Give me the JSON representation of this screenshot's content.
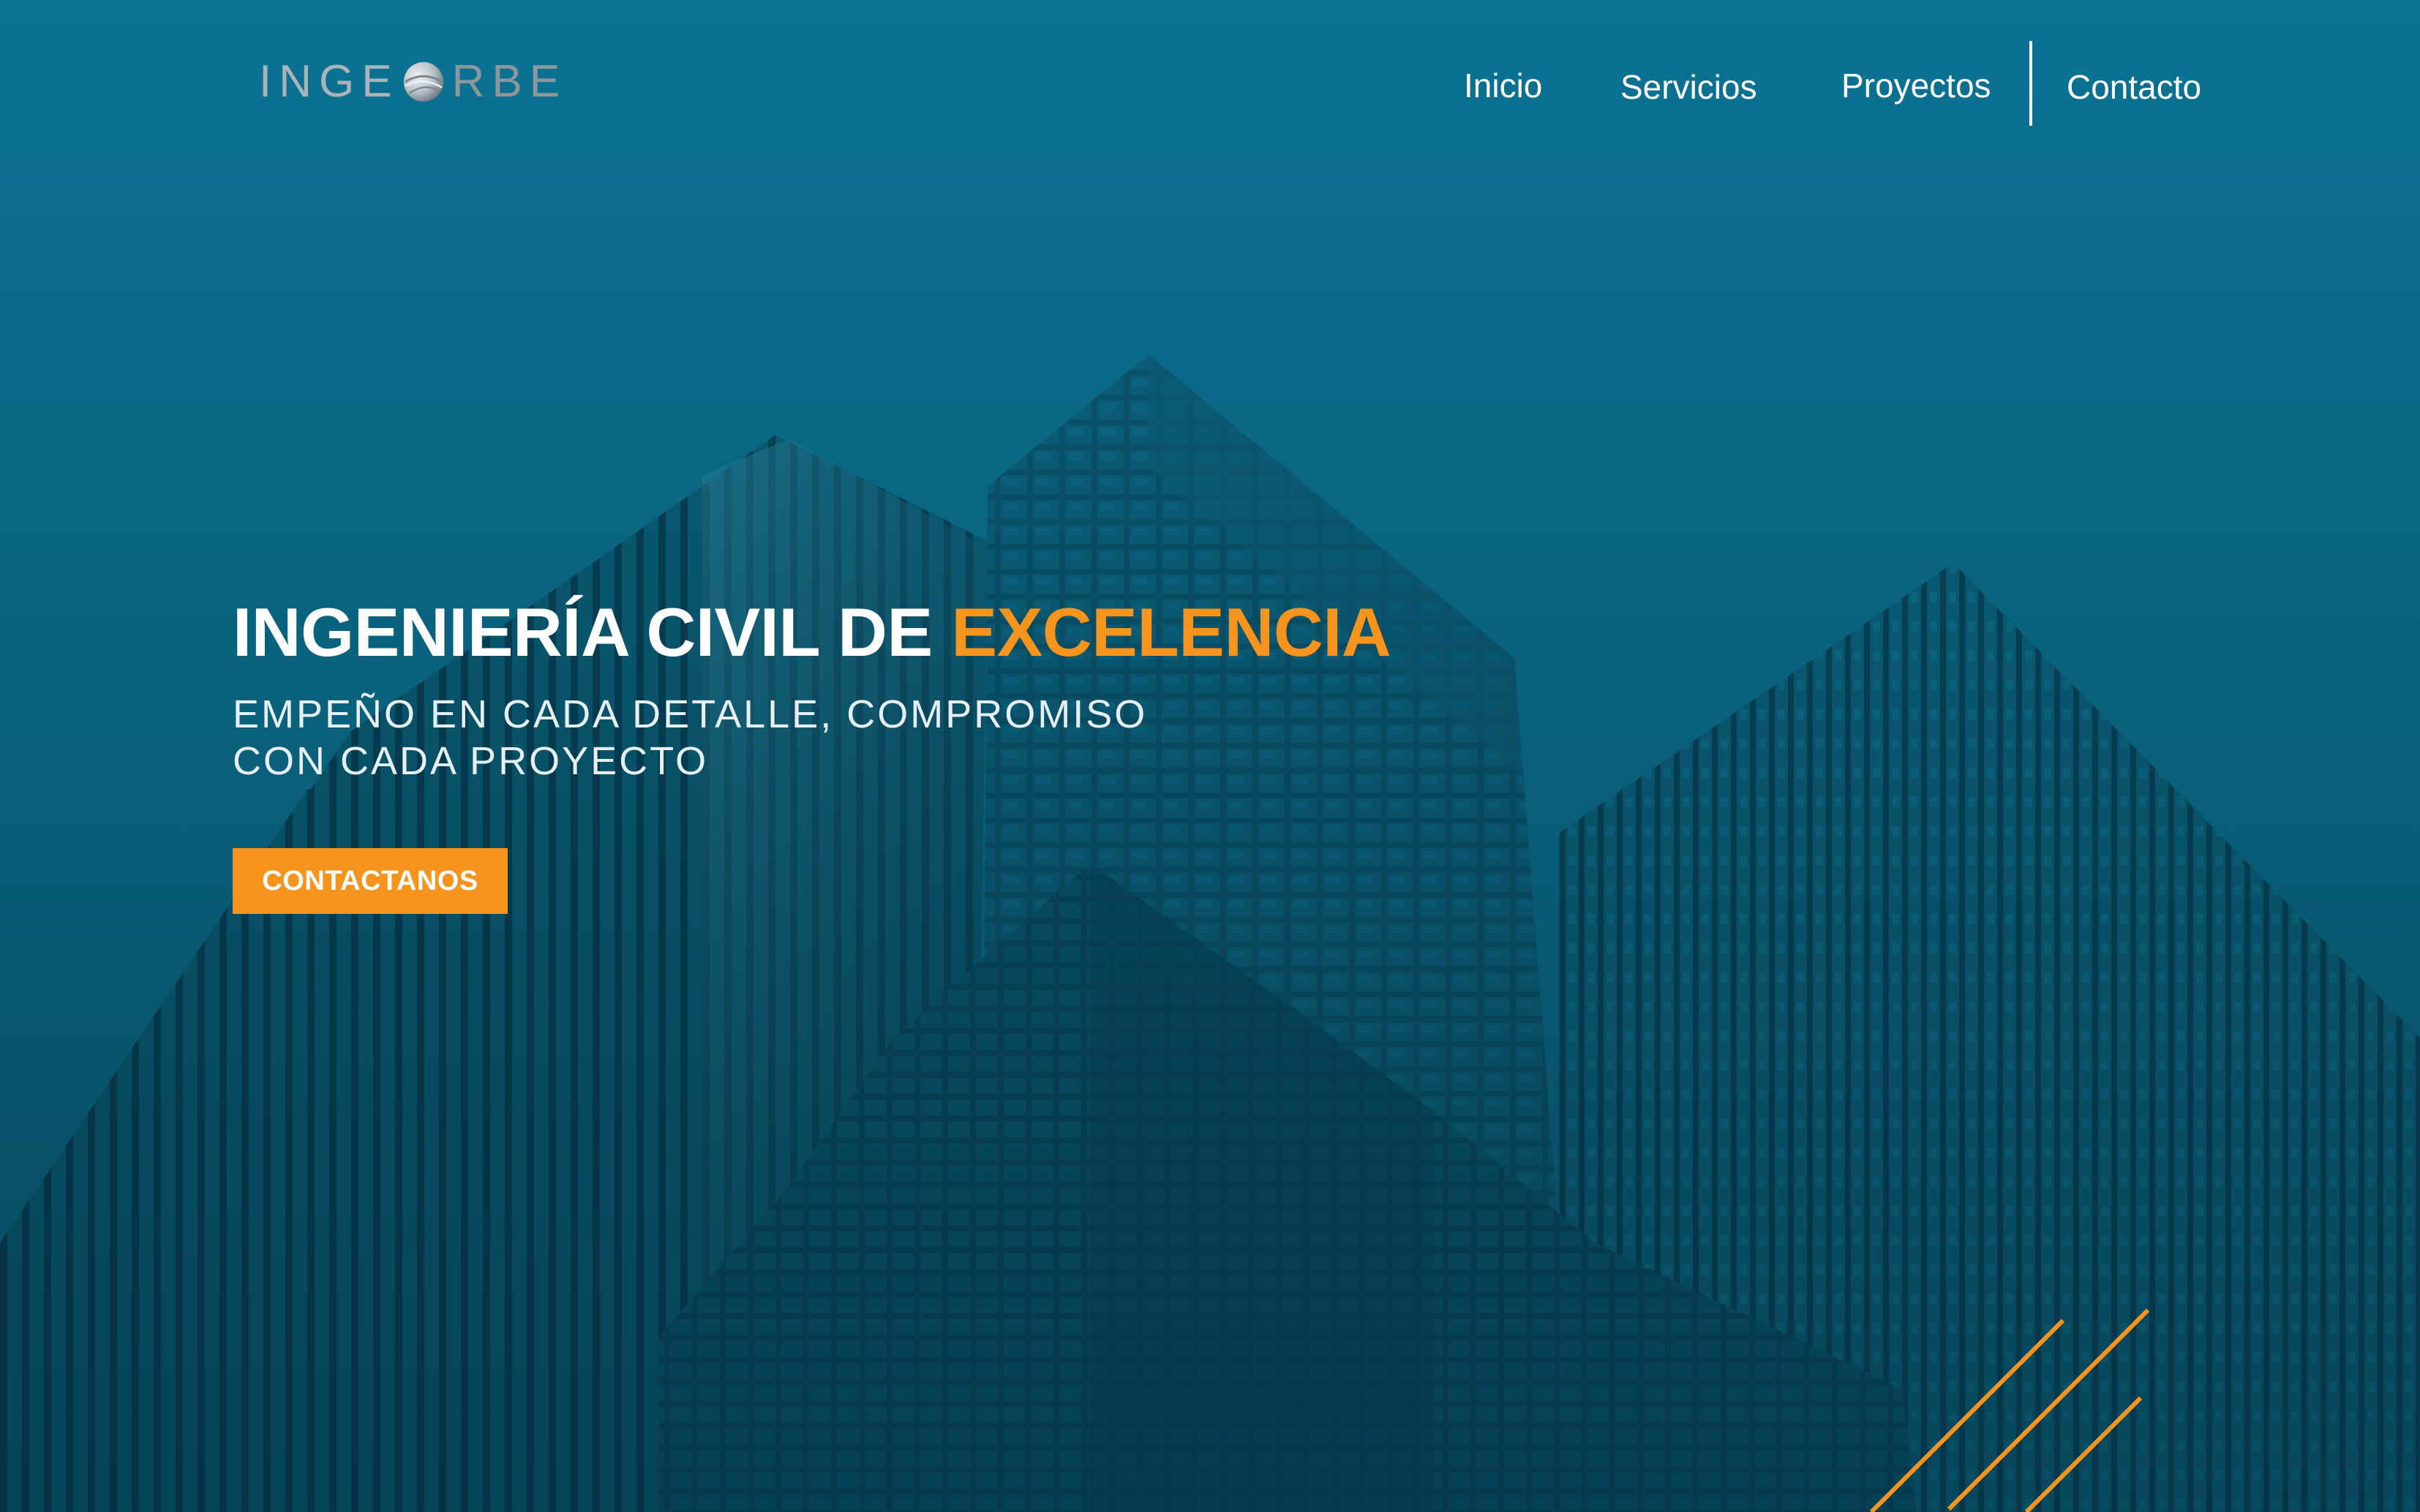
{
  "brand": {
    "logo_left": "INGE",
    "logo_right": "RBE",
    "logo_color": "#a9b3ba"
  },
  "nav": {
    "items": [
      {
        "label": "Inicio"
      },
      {
        "label": "Servicios"
      },
      {
        "label": "Proyectos"
      },
      {
        "label": "Contacto"
      }
    ]
  },
  "hero": {
    "title_main": "INGENIERÍA CIVIL DE ",
    "title_accent": "EXCELENCIA",
    "subtitle_line1": "EMPEÑO EN CADA DETALLE, COMPROMISO",
    "subtitle_line2": "CON CADA PROYECTO",
    "cta_label": "CONTACTANOS"
  },
  "colors": {
    "accent": "#f7941d",
    "overlay": "#0a7594",
    "text": "#ffffff"
  },
  "icons": {
    "logo_mark": "globe-icon",
    "decoration": "diagonal-lines"
  }
}
